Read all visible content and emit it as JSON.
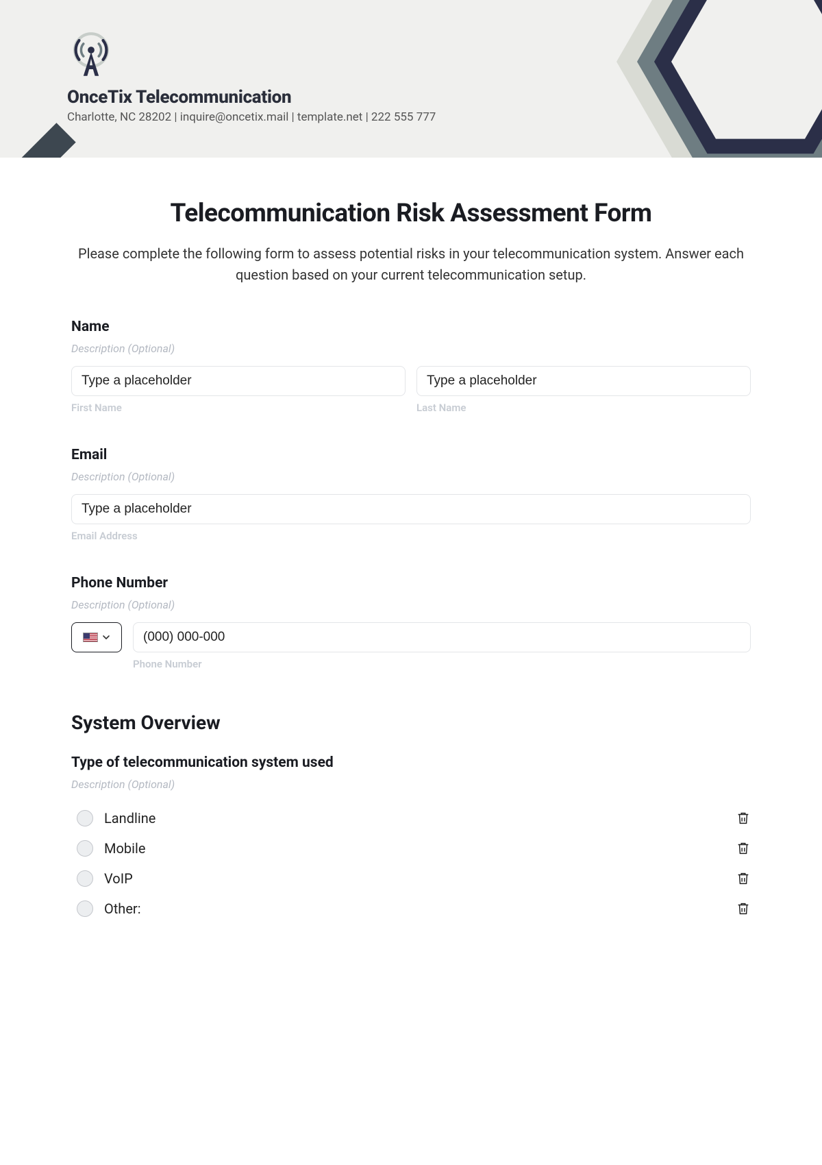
{
  "header": {
    "company_name": "OnceTix Telecommunication",
    "company_sub": "Charlotte, NC 28202 | inquire@oncetix.mail | template.net | 222 555 777"
  },
  "form": {
    "title": "Telecommunication Risk Assessment Form",
    "description": "Please complete the following form to assess potential risks in your telecommunication system. Answer each question based on your current telecommunication setup."
  },
  "fields": {
    "name": {
      "label": "Name",
      "desc": "Description (Optional)",
      "first_placeholder": "Type a placeholder",
      "first_sub": "First Name",
      "last_placeholder": "Type a placeholder",
      "last_sub": "Last Name"
    },
    "email": {
      "label": "Email",
      "desc": "Description (Optional)",
      "placeholder": "Type a placeholder",
      "sub": "Email Address"
    },
    "phone": {
      "label": "Phone Number",
      "desc": "Description (Optional)",
      "placeholder": "(000) 000-000",
      "sub": "Phone Number"
    }
  },
  "section": {
    "overview": "System Overview",
    "system_type": {
      "label": "Type of telecommunication system used",
      "desc": "Description (Optional)",
      "options": [
        "Landline",
        "Mobile",
        "VoIP",
        "Other:"
      ]
    }
  }
}
